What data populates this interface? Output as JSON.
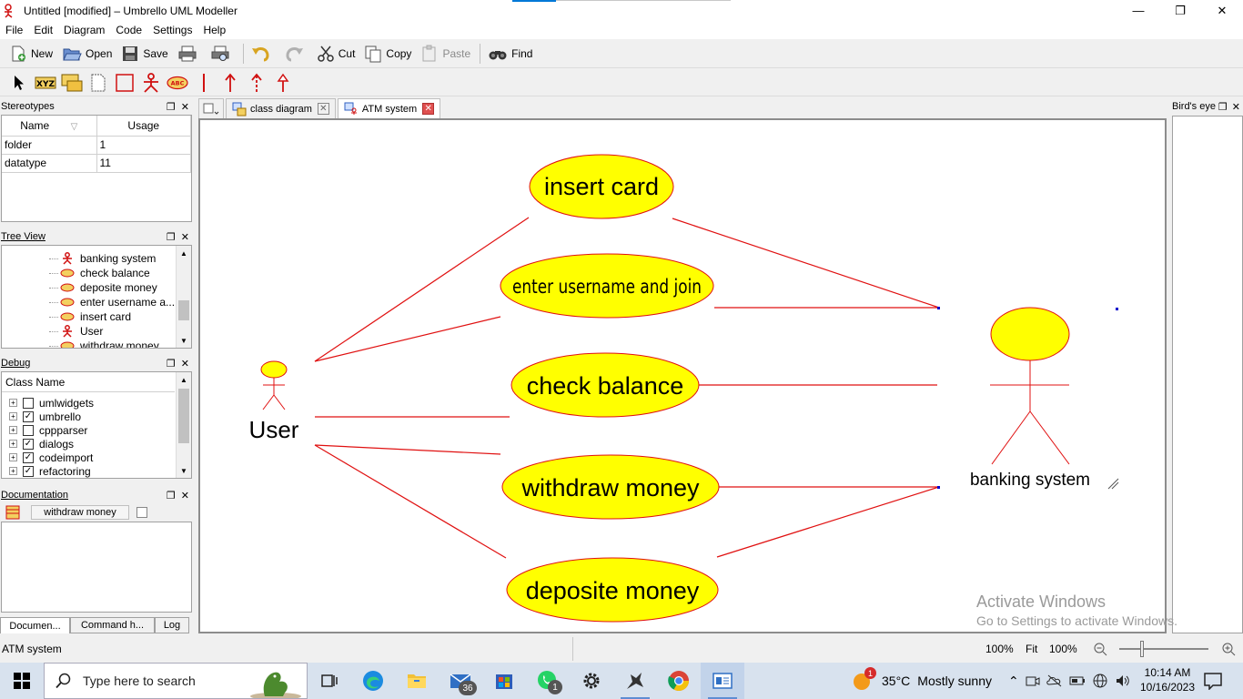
{
  "window": {
    "title": "Untitled [modified] – Umbrello UML Modeller",
    "controls": [
      "—",
      "❐",
      "✕"
    ]
  },
  "menu": [
    "File",
    "Edit",
    "Diagram",
    "Code",
    "Settings",
    "Help"
  ],
  "toolbar": {
    "new": "New",
    "open": "Open",
    "save": "Save",
    "cut": "Cut",
    "copy": "Copy",
    "paste": "Paste",
    "find": "Find"
  },
  "stereotypes": {
    "title": "Stereotypes",
    "columns": [
      "Name",
      "Usage"
    ],
    "rows": [
      {
        "name": "folder",
        "usage": "1"
      },
      {
        "name": "datatype",
        "usage": "11"
      }
    ]
  },
  "tree_view": {
    "title": "Tree View",
    "items": [
      {
        "label": "banking system",
        "icon": "actor-icon"
      },
      {
        "label": "check balance",
        "icon": "usecase-icon"
      },
      {
        "label": "deposite money",
        "icon": "usecase-icon"
      },
      {
        "label": "enter username a...",
        "icon": "usecase-icon"
      },
      {
        "label": "insert card",
        "icon": "usecase-icon"
      },
      {
        "label": "User",
        "icon": "actor-icon"
      },
      {
        "label": "withdraw money",
        "icon": "usecase-icon"
      }
    ]
  },
  "debug": {
    "title": "Debug",
    "column": "Class Name",
    "rows": [
      {
        "label": "umlwidgets",
        "checked": false
      },
      {
        "label": "umbrello",
        "checked": true
      },
      {
        "label": "cppparser",
        "checked": false
      },
      {
        "label": "dialogs",
        "checked": true
      },
      {
        "label": "codeimport",
        "checked": true
      },
      {
        "label": "refactoring",
        "checked": true
      }
    ]
  },
  "documentation": {
    "title": "Documentation",
    "field": "withdraw money",
    "tabs": [
      "Documen...",
      "Command h...",
      "Log"
    ]
  },
  "tabs": [
    {
      "label": "class diagram",
      "close": "✕"
    },
    {
      "label": "ATM system",
      "close": "✕"
    }
  ],
  "diagram": {
    "actors": {
      "user": "User",
      "system": "banking system"
    },
    "usecases": {
      "insert": "insert card",
      "enter": "enter username and join",
      "check": "check balance",
      "withdraw": "withdraw money",
      "deposit": "deposite money"
    },
    "colors": {
      "fill": "#ffff00",
      "line": "#e01010"
    }
  },
  "birds_eye": {
    "title": "Bird's eye"
  },
  "status": {
    "message": "ATM system",
    "zoom1": "100%",
    "fit": "Fit",
    "zoom2": "100%"
  },
  "watermark": {
    "line1": "Activate Windows",
    "line2": "Go to Settings to activate Windows."
  },
  "taskbar": {
    "search_placeholder": "Type here to search",
    "mail_badge": "36",
    "whatsapp_badge": "1",
    "weather_badge": "1",
    "temperature": "35°C",
    "weather": "Mostly sunny",
    "time": "10:14 AM",
    "date": "10/16/2023"
  }
}
